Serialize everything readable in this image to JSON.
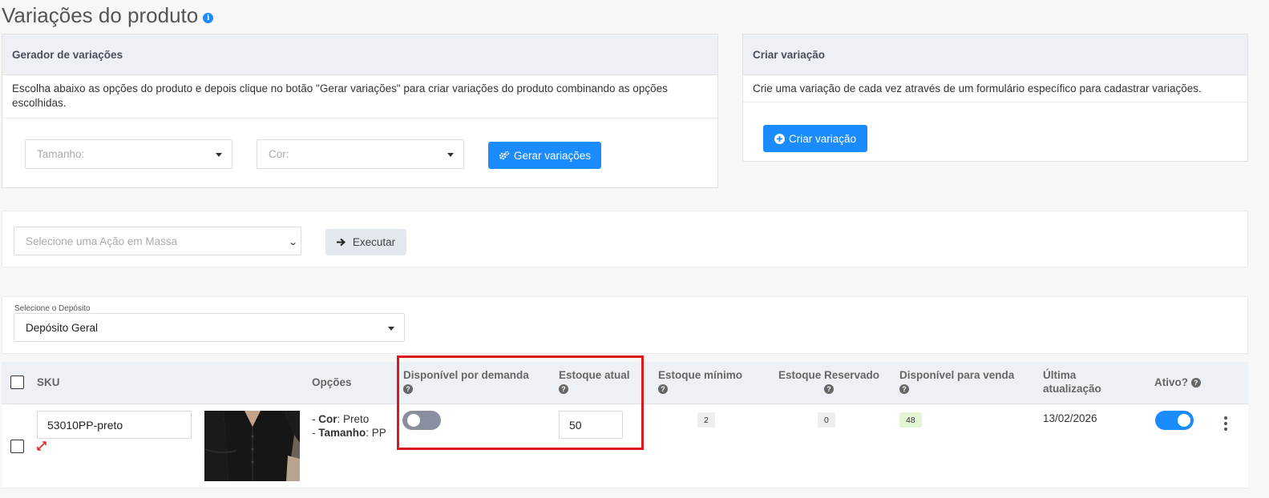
{
  "page": {
    "title": "Variações do produto",
    "info_icon": "info-icon"
  },
  "generator": {
    "header": "Gerador de variações",
    "description": "Escolha abaixo as opções do produto e depois clique no botão \"Gerar variações\" para criar variações do produto combinando as opções escolhidas.",
    "size_placeholder": "Tamanho:",
    "color_placeholder": "Cor:",
    "generate_label": "Gerar variações"
  },
  "create": {
    "header": "Criar variação",
    "description": "Crie uma variação de cada vez através de um formulário específico para cadastrar variações.",
    "button_label": "Criar variação"
  },
  "bulk": {
    "select_placeholder": "Selecione uma Ação em Massa",
    "execute_label": "Executar"
  },
  "warehouse": {
    "label": "Selecione o Depósito",
    "value": "Depósito Geral"
  },
  "table": {
    "headers": {
      "sku": "SKU",
      "options": "Opções",
      "on_demand": "Disponível por demanda",
      "current_stock": "Estoque atual",
      "min_stock": "Estoque mínimo",
      "reserved_stock": "Estoque Reservado",
      "available": "Disponível para venda",
      "last_update_1": "Última",
      "last_update_2": "atualização",
      "active": "Ativo?"
    },
    "rows": [
      {
        "sku": "53010PP-preto",
        "option_color_key": "Cor",
        "option_color_value": ": Preto",
        "option_size_key": "Tamanho",
        "option_size_value": ": PP",
        "option_prefix": "- ",
        "on_demand": false,
        "current_stock": "50",
        "min_stock": "2",
        "reserved_stock": "0",
        "available": "48",
        "last_update": "13/02/2026",
        "active": true
      }
    ]
  },
  "colors": {
    "primary": "#1a8cff",
    "highlight": "#d9191c",
    "available_badge": "#e3f5d3",
    "neutral_badge": "#eeeeee"
  }
}
